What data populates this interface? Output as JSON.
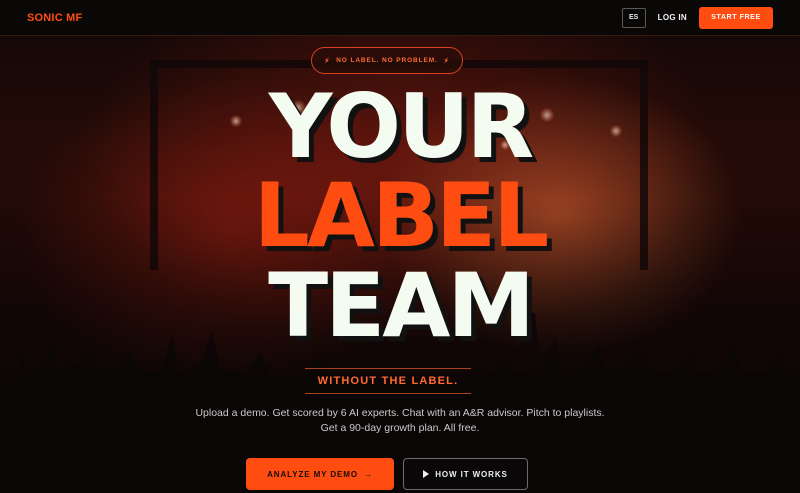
{
  "header": {
    "brand": "SONIC MF",
    "lang_label": "ES",
    "login_label": "LOG IN",
    "start_label": "START FREE"
  },
  "hero": {
    "pill_label": "NO LABEL. NO PROBLEM.",
    "pill_icon": "lightning-bolt-icon",
    "headline_line1": "YOUR",
    "headline_line2": "LABEL",
    "headline_line3": "TEAM",
    "subhead": "WITHOUT THE LABEL.",
    "description_line1": "Upload a demo. Get scored by 6 AI experts. Chat with an A&R advisor. Pitch to playlists.",
    "description_line2": "Get a 90-day growth plan. All free.",
    "cta_primary_label": "ANALYZE MY DEMO",
    "cta_primary_arrow": "→",
    "cta_secondary_label": "HOW IT WORKS",
    "cta_secondary_icon": "play-icon"
  },
  "colors": {
    "accent": "#ff4d12",
    "headline_light": "#f4fbf1",
    "background": "#0b0808"
  }
}
